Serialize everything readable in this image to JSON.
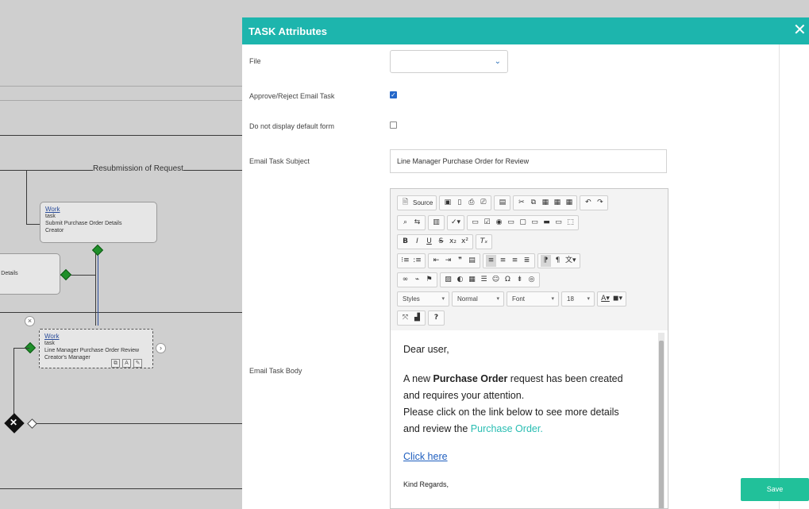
{
  "workflow": {
    "edge_label": "Resubmission of Request",
    "left_node_partial_label": "r Details",
    "node1": {
      "title": "Work",
      "type": "task",
      "name": "Submit Purchase Order Details",
      "assignee": "Creator"
    },
    "node2": {
      "title": "Work",
      "type": "task",
      "name": "Line Manager Purchase Order Review",
      "assignee": "Creator's Manager"
    },
    "gateway_x_symbol": "✕",
    "close_circle_symbol": "×",
    "arrow_circle_symbol": "›"
  },
  "panel": {
    "title": "TASK Attributes",
    "close_symbol": "✕",
    "fields": {
      "file_label": "File",
      "file_value": "",
      "approve_reject_label": "Approve/Reject Email Task",
      "approve_reject_checked": true,
      "no_default_form_label": "Do not display default form",
      "no_default_form_checked": false,
      "subject_label": "Email Task Subject",
      "subject_value": "Line Manager Purchase Order for Review",
      "body_label": "Email Task Body"
    },
    "editor": {
      "source_label": "Source",
      "styles_label": "Styles",
      "format_label": "Normal",
      "font_label": "Font",
      "size_label": "18",
      "body": {
        "greeting": "Dear user,",
        "line1_pre": "A new ",
        "line1_bold": "Purchase Order",
        "line1_post": " request has been created",
        "line2": "and requires your attention.",
        "line3": "Please click on the link below to see more details",
        "line4_pre": "and review the ",
        "line4_link": "Purchase Order.",
        "click_here": "Click here",
        "closing": "Kind Regards,"
      }
    },
    "save_label": "Save"
  },
  "colors": {
    "header": "#1db5ad",
    "save": "#21c19a",
    "checkbox": "#2467c9",
    "gateway": "#1f8f2a"
  }
}
